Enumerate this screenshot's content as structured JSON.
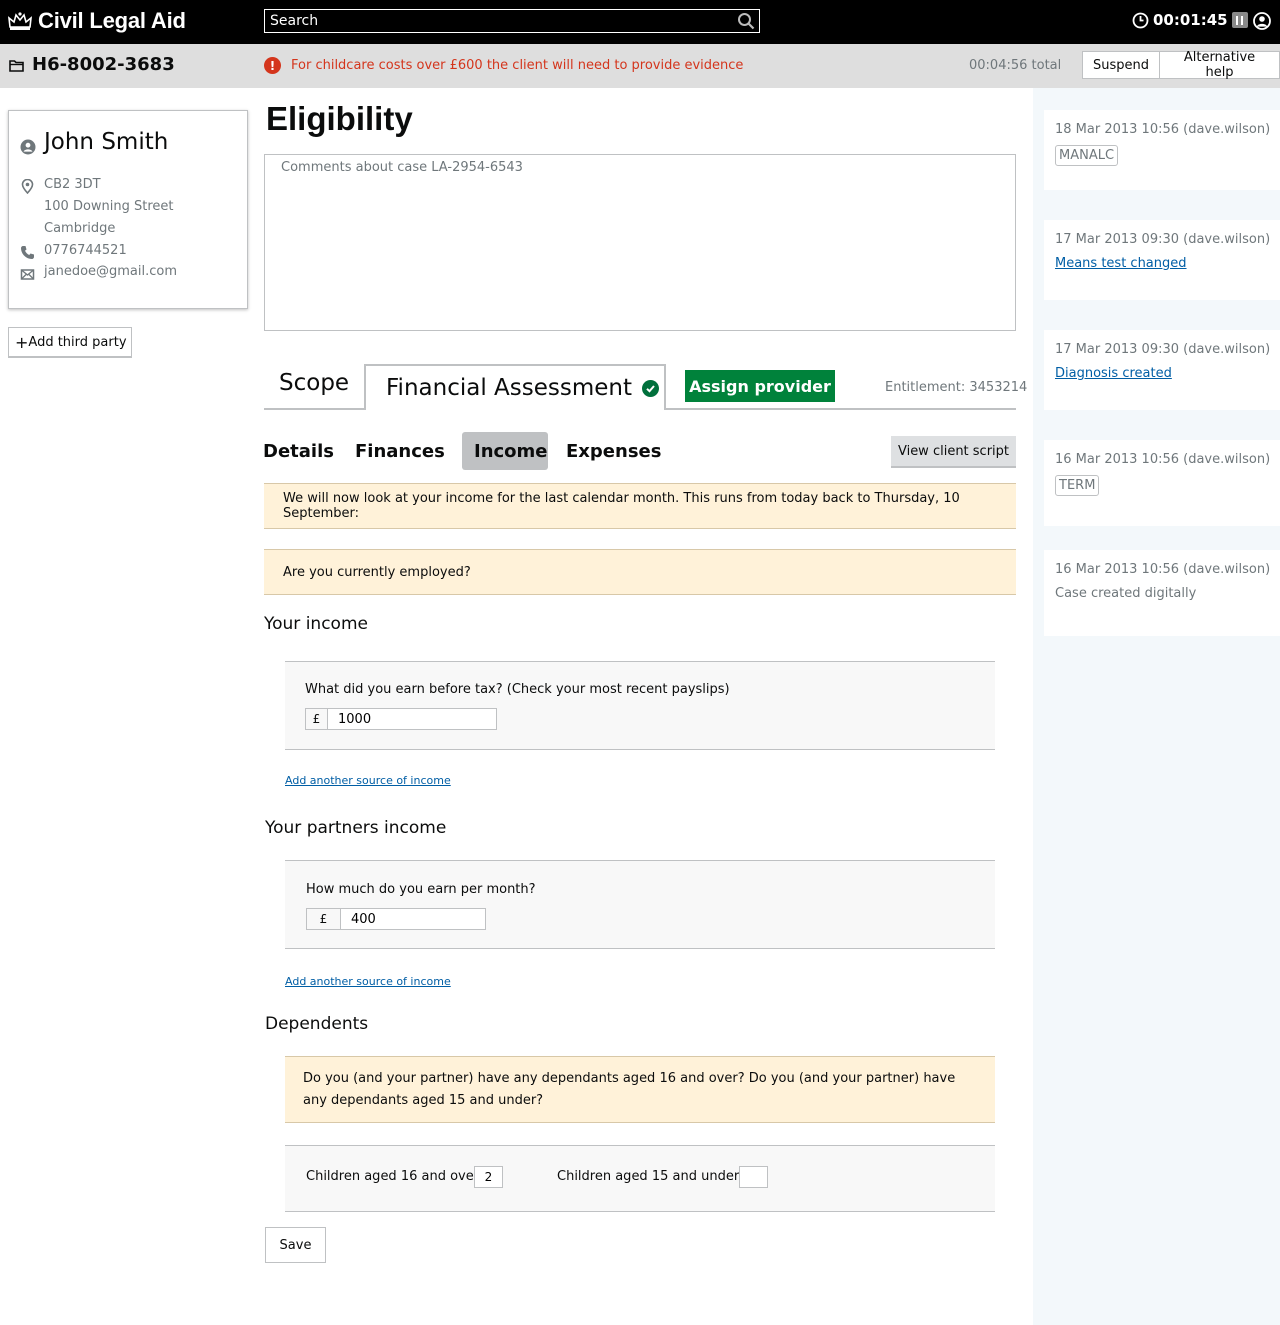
{
  "header": {
    "app_name": "Civil Legal Aid",
    "search_placeholder": "Search",
    "timer": "00:01:45",
    "accent": "#000000"
  },
  "case_bar": {
    "case_ref": "H6-8002-3683",
    "alert": "For childcare costs over £600 the client will need to provide evidence",
    "total_time": "00:04:56 total",
    "suspend_label": "Suspend",
    "alt_help_label": "Alternative help",
    "alert_color": "#d4351c"
  },
  "client": {
    "name": "John Smith",
    "postcode": "CB2 3DT",
    "street": "100 Downing Street",
    "city": "Cambridge",
    "phone": "0776744521",
    "email": "janedoe@gmail.com",
    "add_third_party_label": "Add third party"
  },
  "main": {
    "title": "Eligibility",
    "comments_placeholder": "Comments about case LA-2954-6543",
    "tabs": [
      {
        "label": "Scope"
      },
      {
        "label": "Financial Assessment",
        "complete": true
      }
    ],
    "assign_provider_label": "Assign provider",
    "entitlement": "Entitlement: 3453214",
    "subnav": [
      {
        "label": "Details"
      },
      {
        "label": "Finances"
      },
      {
        "label": "Income",
        "active": true
      },
      {
        "label": "Expenses"
      }
    ],
    "view_script_label": "View client script",
    "intro_notice": "We will now look at your income for the last calendar month. This runs from today back to Thursday, 10 September:",
    "employed_question": "Are you currently employed?",
    "your_income": {
      "heading": "Your income",
      "question": "What did you earn before tax? (Check your most recent payslips)",
      "currency": "£",
      "value": "1000",
      "add_link": "Add another source of income"
    },
    "partner_income": {
      "heading": "Your partners income",
      "question": "How much do you earn per month?",
      "currency": "£",
      "value": "400",
      "add_link": "Add another source of income"
    },
    "dependents": {
      "heading": "Dependents",
      "question": "Do you (and your partner) have any dependants aged 16 and over? Do you (and your partner) have any dependants aged 15 and under?",
      "over16_label": "Children aged 16 and over",
      "over16_value": "2",
      "under15_label": "Children aged 15 and under",
      "under15_value": ""
    },
    "save_label": "Save",
    "success_color": "#00823b"
  },
  "timeline": [
    {
      "meta": "18 Mar 2013 10:56 (dave.wilson)",
      "kind": "tag",
      "text": "MANALC"
    },
    {
      "meta": "17 Mar 2013 09:30 (dave.wilson)",
      "kind": "link",
      "text": "Means test changed"
    },
    {
      "meta": "17 Mar 2013 09:30 (dave.wilson)",
      "kind": "link",
      "text": "Diagnosis created"
    },
    {
      "meta": "16 Mar 2013 10:56 (dave.wilson)",
      "kind": "tag",
      "text": "TERM"
    },
    {
      "meta": "16 Mar 2013 10:56 (dave.wilson)",
      "kind": "text",
      "text": "Case created digitally"
    }
  ]
}
